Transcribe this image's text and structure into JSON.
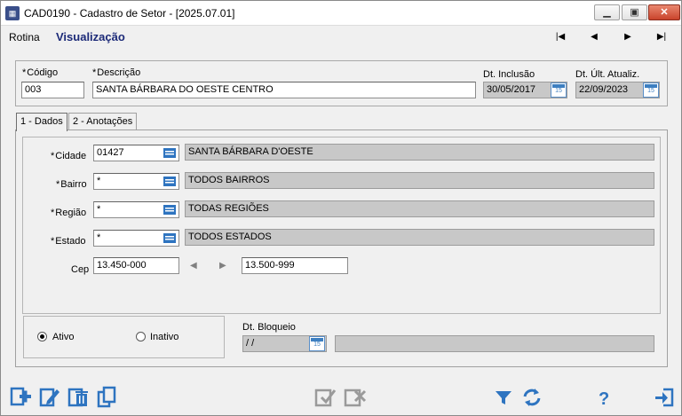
{
  "window": {
    "title": "CAD0190 - Cadastro de Setor - [2025.07.01]",
    "icon": "app-grid-icon",
    "controls": [
      "minimize-icon",
      "maximize-icon",
      "close-icon"
    ]
  },
  "menubar": {
    "rotina_label": "Rotina",
    "mode_label": "Visualização",
    "nav": [
      "first-record-icon",
      "previous-record-icon",
      "next-record-icon",
      "last-record-icon"
    ]
  },
  "header": {
    "codigo_label": "Código",
    "codigo_value": "003",
    "descricao_label": "Descrição",
    "descricao_value": "SANTA BÁRBARA DO OESTE CENTRO",
    "dt_inclusao_label": "Dt. Inclusão",
    "dt_inclusao_value": "30/05/2017",
    "dt_ult_atualiz_label": "Dt. Últ. Atualiz.",
    "dt_ult_atualiz_value": "22/09/2023",
    "required_marker": "*",
    "calendar_day": "15"
  },
  "tabs": [
    {
      "label": "1 - Dados",
      "active": true
    },
    {
      "label": "2 - Anotações",
      "active": false
    }
  ],
  "dados": {
    "cidade_label": "Cidade",
    "cidade_code": "01427",
    "cidade_name": "SANTA BÁRBARA D'OESTE",
    "bairro_label": "Bairro",
    "bairro_code": "*",
    "bairro_name": "TODOS BAIRROS",
    "regiao_label": "Região",
    "regiao_code": "*",
    "regiao_name": "TODAS REGIÕES",
    "estado_label": "Estado",
    "estado_code": "*",
    "estado_name": "TODOS ESTADOS",
    "cep_label": "Cep",
    "cep_from": "13.450-000",
    "cep_to": "13.500-999"
  },
  "status": {
    "ativo_label": "Ativo",
    "inativo_label": "Inativo",
    "selected": "Ativo",
    "dt_bloqueio_label": "Dt. Bloqueio",
    "dt_bloqueio_value": "/ /",
    "bloqueio_desc": ""
  },
  "toolbar": {
    "left": [
      "add-icon",
      "edit-icon",
      "delete-icon",
      "copy-icon"
    ],
    "center": [
      "confirm-icon",
      "cancel-icon"
    ],
    "right": [
      "filter-icon",
      "refresh-icon",
      "help-icon",
      "exit-icon"
    ]
  },
  "colors": {
    "accent_blue": "#2e74c0",
    "mode_text": "#1c2a78",
    "readonly_field": "#c8c8c8",
    "disabled_icon": "#9a9a9a",
    "close_red": "#c9442c"
  }
}
